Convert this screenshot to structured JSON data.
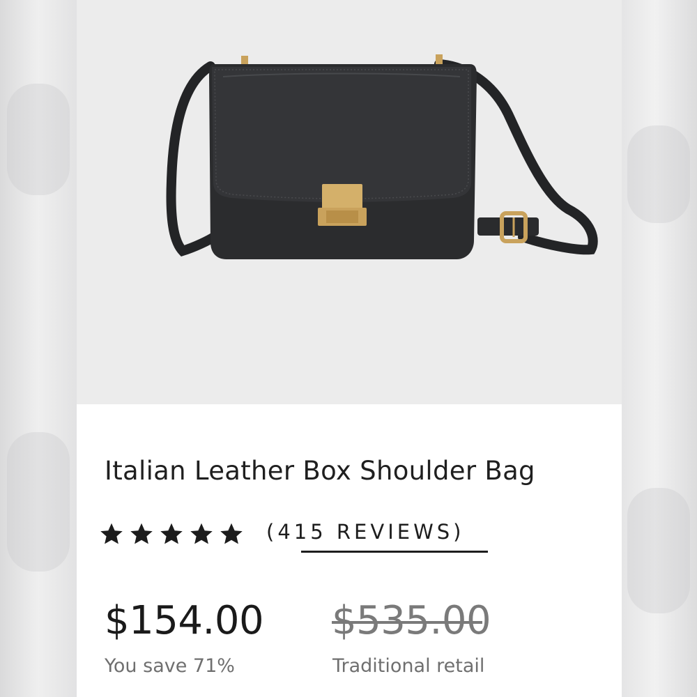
{
  "product": {
    "title": "Italian Leather Box Shoulder Bag",
    "image_subject": "black-leather-box-shoulder-bag",
    "rating": {
      "stars": 5,
      "max_stars": 5,
      "reviews_text": "(415 REVIEWS)"
    },
    "price": {
      "current": "$154.00",
      "savings_text": "You save 71%",
      "original": "$535.00",
      "original_label": "Traditional retail"
    }
  },
  "colors": {
    "text": "#1f1f1f",
    "muted": "#6f6f6f",
    "strike_price": "#7a7a7a",
    "image_bg": "#ececec",
    "hardware_gold": "#c9a25c",
    "leather": "#2b2c2e"
  }
}
